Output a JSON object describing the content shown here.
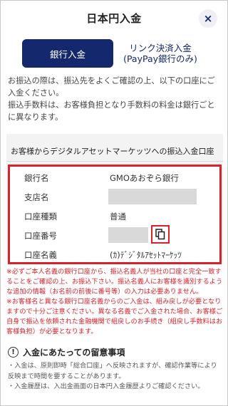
{
  "header": {
    "title": "日本円入金",
    "close_symbol": "×"
  },
  "tabs": [
    {
      "label": "銀行入金",
      "active": true
    },
    {
      "line1": "リンク決済入金",
      "line2": "(PayPay銀行のみ)",
      "active": false
    }
  ],
  "intro": {
    "paragraph1": "お振込の際は、振込先をよくご確認の上、以下の口座にご入金ください。",
    "paragraph2": "振込手数料は、お客様負担となり手数料の料金は銀行ごとに異なります。"
  },
  "account": {
    "heading": "お客様からデジタルアセットマーケッツへの振込入金口座",
    "rows": [
      {
        "label": "銀行名",
        "value": "GMOあおぞら銀行"
      },
      {
        "label": "支店名",
        "value": ""
      },
      {
        "label": "口座種類",
        "value": "普通"
      },
      {
        "label": "口座番号",
        "value": ""
      },
      {
        "label": "口座名義",
        "value": "(ｶ)ﾃﾞｼﾞﾀﾙｱｾｯﾄﾏｰｹｯﾂ"
      }
    ]
  },
  "notes": {
    "note1": "※必ずご本人名義の銀行口座から、振込名義人が当社の口座と完全一致することをご確認の上、お振込下さい。振込名義人にお客様を識別するような追加の情報（お名前の前後に番号等）の入力は必要ありません。",
    "note2": "※お客様名と異なる銀行口座名義からのご入金は、組み戻しが必要となりますので十分ご注意ください。異なる名義でご入金された場合、お客様ご自身で振込を依頼された金融機関で組戻しのお手続き（組戻し手数料はお客様負担）が必要となります。"
  },
  "caution": {
    "heading": "入金にあたっての留意事項",
    "item1": "・入金は、原則即時「総合口座」へ反映されますが、確認作業等により反映まで時間を要することがあります。",
    "item2": "・入金履歴は、入出金画面の日本円入金履歴よりご確認ください。"
  },
  "colors": {
    "brand": "#14286e",
    "alert": "#d9202b"
  }
}
